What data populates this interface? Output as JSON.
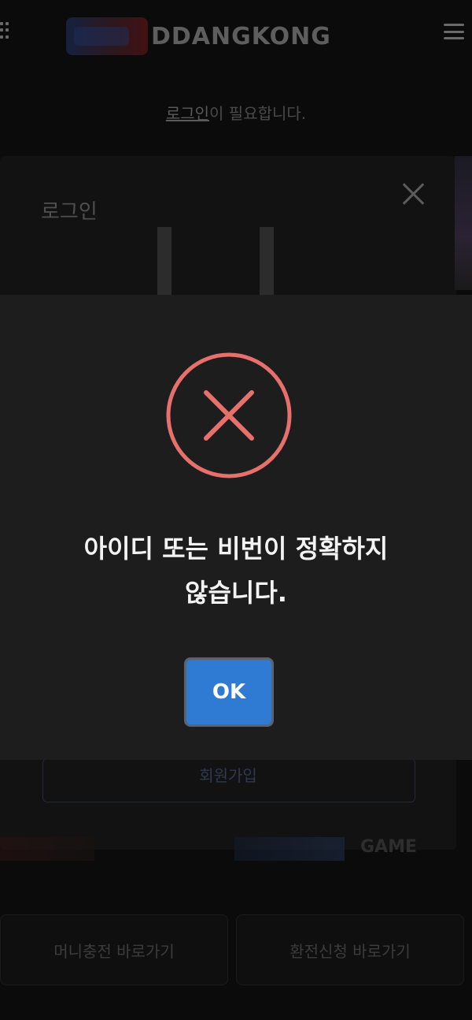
{
  "header": {
    "logo_text": "DDANGKONG",
    "grid_icon": "grid-icon",
    "menu_icon": "menu-icon"
  },
  "notice": {
    "link": "로그인",
    "rest": "이 필요합니다."
  },
  "login_panel": {
    "title": "로그인",
    "close_icon": "close-icon",
    "signup_label": "회원가입",
    "game_label": "GAME"
  },
  "bottom_buttons": {
    "money_charge": "머니충전 바로가기",
    "exchange_request": "환전신청 바로가기"
  },
  "modal": {
    "icon": "error-x-circle-icon",
    "message_line1": "아이디 또는 비번이 정확하지",
    "message_line2": "않습니다.",
    "ok_label": "OK",
    "colors": {
      "modal_bg": "#1d1d1d",
      "error_icon": "#e8706c",
      "ok_button": "#2f7bd3"
    }
  }
}
